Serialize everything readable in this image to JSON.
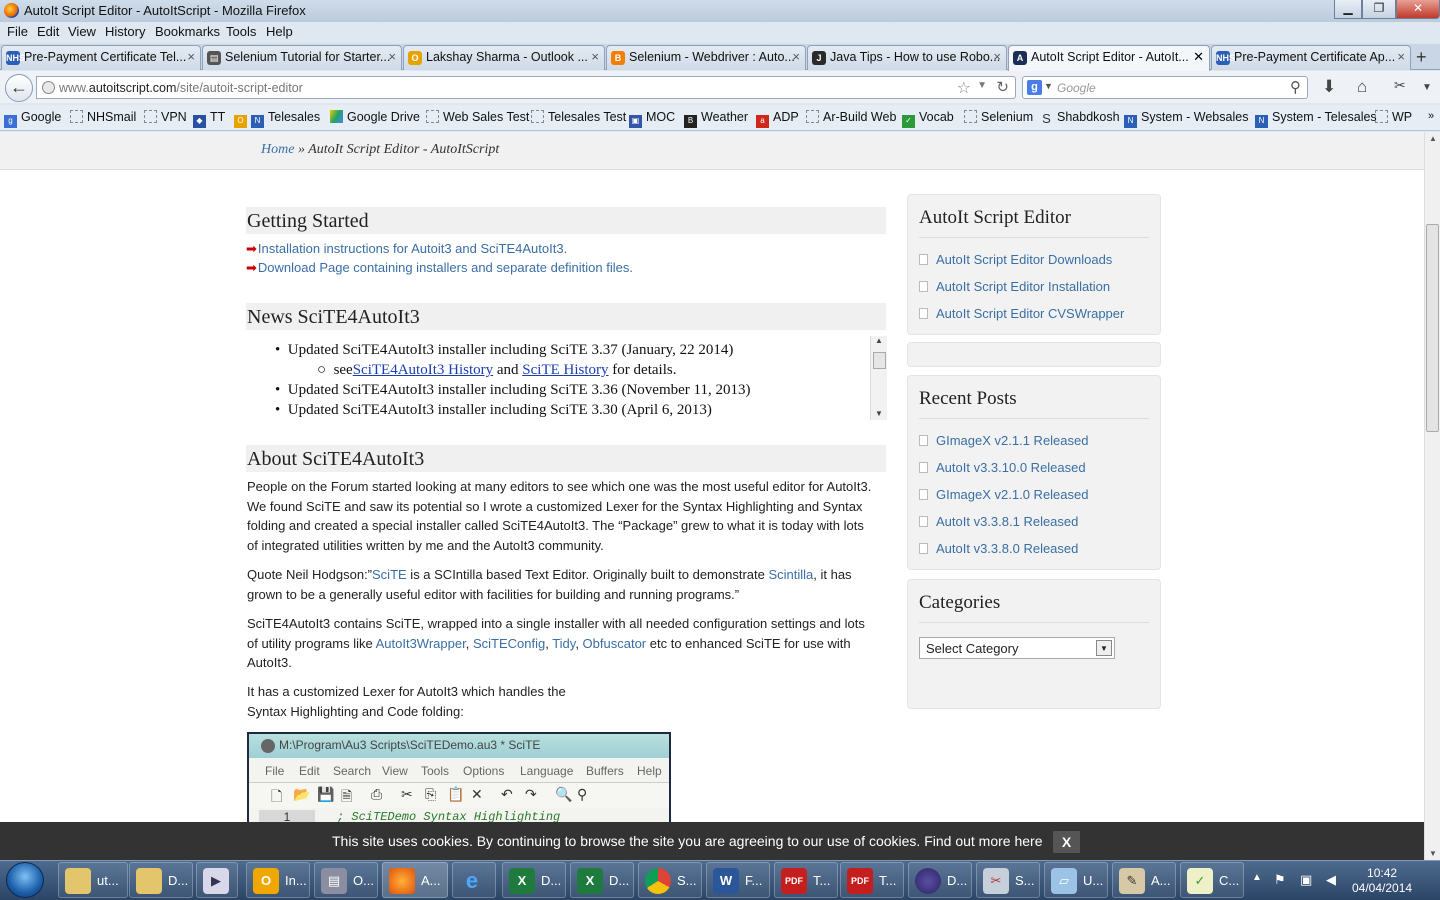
{
  "window": {
    "title": "AutoIt Script Editor - AutoItScript - Mozilla Firefox"
  },
  "menu": [
    "File",
    "Edit",
    "View",
    "History",
    "Bookmarks",
    "Tools",
    "Help"
  ],
  "tabs": [
    {
      "label": "Pre-Payment Certificate Tel...",
      "icon": "nhs-icon"
    },
    {
      "label": "Selenium Tutorial for Starter...",
      "icon": "printer-icon"
    },
    {
      "label": "Lakshay Sharma - Outlook ...",
      "icon": "outlook-icon"
    },
    {
      "label": "Selenium - Webdriver : Auto...",
      "icon": "blogger-icon"
    },
    {
      "label": "Java Tips - How to use Robo...",
      "icon": "java-icon"
    },
    {
      "label": "AutoIt Script Editor - AutoIt...",
      "icon": "autoit-icon",
      "active": true
    },
    {
      "label": "Pre-Payment Certificate Ap...",
      "icon": "nhs-icon"
    }
  ],
  "nav": {
    "url_prefix": "www.",
    "url_domain": "autoitscript.com",
    "url_path": "/site/autoit-script-editor",
    "search_placeholder": "Google"
  },
  "bookmarks": [
    "Google",
    "NHSmail",
    "VPN",
    "TT",
    "Telesales",
    "Google Drive",
    "Web Sales Test",
    "Telesales Test",
    "MOC",
    "Weather",
    "ADP",
    "Ar-Build Web",
    "Vocab",
    "Selenium",
    "Shabdkosh",
    "System - Websales",
    "System - Telesales",
    "WP"
  ],
  "breadcrumb": {
    "home": "Home",
    "sep": " » ",
    "current": "AutoIt Script Editor - AutoItScript"
  },
  "getting_started": {
    "heading": "Getting Started",
    "links": [
      "Installation instructions for Autoit3 and SciTE4AutoIt3.",
      "Download Page containing installers and separate definition files."
    ]
  },
  "news": {
    "heading": "News SciTE4AutoIt3",
    "item1": "Updated SciTE4AutoIt3 installer including SciTE 3.37 (January, 22 2014)",
    "sub_see": "see",
    "sub_link1": "SciTE4AutoIt3 History",
    "sub_and": " and ",
    "sub_link2": "SciTE History",
    "sub_end": " for details.",
    "item2": "Updated SciTE4AutoIt3 installer including SciTE 3.36 (November 11, 2013)",
    "item3": "Updated SciTE4AutoIt3 installer including SciTE 3.30 (April 6, 2013)"
  },
  "about": {
    "heading": "About SciTE4AutoIt3",
    "p1": "People on the Forum started looking at many editors to see which one was the most useful editor for AutoIt3. We found SciTE and saw its potential so I wrote a customized Lexer for the Syntax Highlighting and Syntax folding and created a special installer called SciTE4AutoIt3. The “Package” grew to what it is today with lots of integrated utilities written by me and the AutoIt3 community.",
    "p2_a": "Quote Neil Hodgson:”",
    "p2_link1": "SciTE",
    "p2_b": " is a SCIntilla based Text Editor. Originally built to demonstrate ",
    "p2_link2": "Scintilla",
    "p2_c": ", it has grown to be a generally useful editor with facilities for building and running programs.”",
    "p3_a": "SciTE4AutoIt3 contains SciTE, wrapped into a single installer with all needed configuration settings and lots of utility programs like ",
    "p3_l1": "AutoIt3Wrapper",
    "p3_l2": "SciTEConfig",
    "p3_l3": "Tidy",
    "p3_l4": "Obfuscator",
    "p3_b": " etc to enhanced SciTE for use with AutoIt3.",
    "p4_line1": "It has a customized Lexer for AutoIt3 which handles the",
    "p4_line2": "Syntax Highlighting and Code folding:"
  },
  "scite_image": {
    "title": "M:\\Program\\Au3 Scripts\\SciTEDemo.au3 * SciTE",
    "menu": [
      "File",
      "Edit",
      "Search",
      "View",
      "Tools",
      "Options",
      "Language",
      "Buffers",
      "Help"
    ],
    "line_no": "1",
    "code": "; SciTEDemo Syntax Highlighting"
  },
  "sidebar": {
    "editor": {
      "heading": "AutoIt Script Editor",
      "links": [
        "AutoIt Script Editor Downloads",
        "AutoIt Script Editor Installation",
        "AutoIt Script Editor CVSWrapper"
      ]
    },
    "recent": {
      "heading": "Recent Posts",
      "links": [
        "GImageX v2.1.1 Released",
        "AutoIt v3.3.10.0 Released",
        "GImageX v2.1.0 Released",
        "AutoIt v3.3.8.1 Released",
        "AutoIt v3.3.8.0 Released"
      ]
    },
    "categories": {
      "heading": "Categories",
      "selected": "Select Category"
    }
  },
  "cookie": {
    "text": "This site uses cookies. By continuing to browse the site you are agreeing to our use of cookies. Find out more here",
    "close": "X"
  },
  "taskbar": {
    "items": [
      {
        "label": "ut...",
        "icon": "folder-icon"
      },
      {
        "label": "D...",
        "icon": "folder-icon"
      },
      {
        "label": "",
        "icon": "media-icon"
      },
      {
        "label": "In...",
        "icon": "outlook-icon"
      },
      {
        "label": "O...",
        "icon": "database-icon"
      },
      {
        "label": "A...",
        "icon": "firefox-icon"
      },
      {
        "label": "",
        "icon": "ie-icon"
      },
      {
        "label": "D...",
        "icon": "excel-icon"
      },
      {
        "label": "D...",
        "icon": "excel-icon"
      },
      {
        "label": "S...",
        "icon": "chrome-icon"
      },
      {
        "label": "F...",
        "icon": "word-icon"
      },
      {
        "label": "T...",
        "icon": "pdf-icon"
      },
      {
        "label": "T...",
        "icon": "pdf-icon"
      },
      {
        "label": "D...",
        "icon": "eclipse-icon"
      },
      {
        "label": "S...",
        "icon": "tool-icon"
      },
      {
        "label": "U...",
        "icon": "app-icon"
      },
      {
        "label": "A...",
        "icon": "paint-icon"
      },
      {
        "label": "C...",
        "icon": "chart-icon"
      }
    ],
    "time": "10:42",
    "date": "04/04/2014"
  }
}
